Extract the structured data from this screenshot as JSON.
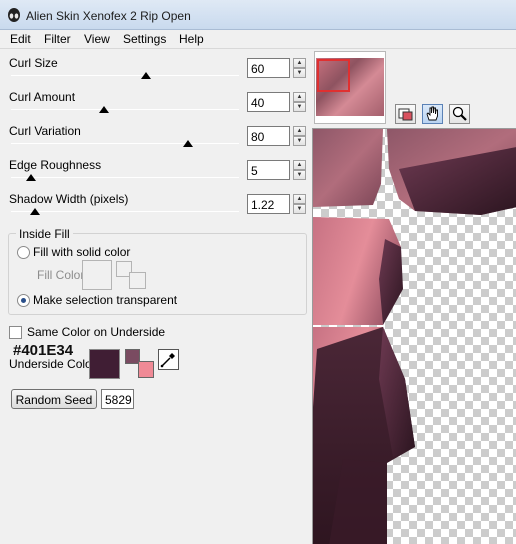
{
  "window": {
    "title": "Alien Skin Xenofex 2 Rip Open"
  },
  "menu": [
    "Edit",
    "Filter",
    "View",
    "Settings",
    "Help"
  ],
  "controls": {
    "curl_size": {
      "label": "Curl Size",
      "value": "60",
      "level": 0.6
    },
    "curl_amount": {
      "label": "Curl Amount",
      "value": "40",
      "level": 0.4
    },
    "curl_variation": {
      "label": "Curl Variation",
      "value": "80",
      "level": 0.8
    },
    "edge_roughness": {
      "label": "Edge Roughness",
      "value": "5",
      "level": 0.05
    },
    "shadow_width": {
      "label": "Shadow Width (pixels)",
      "value": "1.22",
      "level": 0.07
    }
  },
  "inside_fill": {
    "title": "Inside Fill",
    "option_solid": "Fill with solid color",
    "fill_color_label": "Fill Color",
    "option_transparent": "Make selection transparent",
    "selected": "transparent"
  },
  "underside": {
    "same_color_label": "Same Color on Underside",
    "same_color_checked": false,
    "hex": "#401E34",
    "label": "Underside Color",
    "color": "#401E34",
    "recent_color_a": "#7a4b61",
    "recent_color_b": "#f08a96"
  },
  "seed": {
    "button_label": "Random Seed",
    "value": "5829"
  },
  "tools": [
    "preview-selector-icon",
    "hand-icon",
    "zoom-icon"
  ],
  "colors": {
    "accent": "#d26f82",
    "pink_surface": "#c47280",
    "dark_curl": "#3a1e2b",
    "window_bg": "#f0f0f0"
  }
}
